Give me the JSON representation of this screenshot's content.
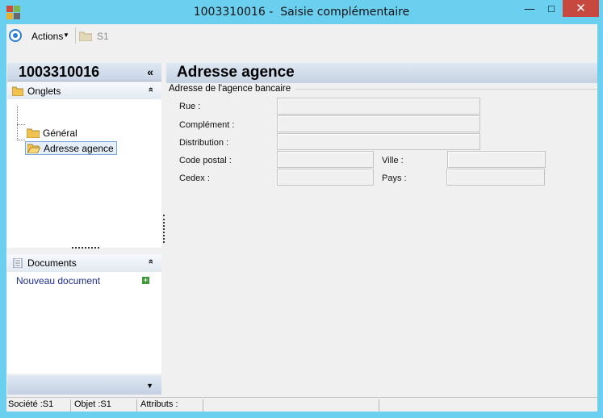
{
  "window": {
    "title": "1003310016 -  Saisie complémentaire",
    "min_glyph": "—",
    "max_glyph": "□",
    "close_glyph": "✕"
  },
  "toolbar": {
    "actions_label": "Actions",
    "caret": "▼",
    "breadcrumb_label": "S1"
  },
  "left": {
    "record_id": "1003310016",
    "collapse_glyph": "«",
    "tabs_section": {
      "label": "Onglets",
      "chevron": "»",
      "items": [
        {
          "label": "Général"
        },
        {
          "label": "Adresse agence",
          "selected": true
        }
      ]
    },
    "documents_section": {
      "label": "Documents",
      "chevron": "»",
      "new_document_label": "Nouveau document",
      "add_glyph": "+"
    },
    "bottom_caret": "▼"
  },
  "main": {
    "page_title": "Adresse agence",
    "group_title": "Adresse de l'agence bancaire",
    "fields": {
      "rue": {
        "label": "Rue :",
        "value": ""
      },
      "complement": {
        "label": "Complément :",
        "value": ""
      },
      "distribution": {
        "label": "Distribution :",
        "value": ""
      },
      "code_postal": {
        "label": "Code postal :",
        "value": ""
      },
      "ville": {
        "label": "Ville :",
        "value": ""
      },
      "cedex": {
        "label": "Cedex :",
        "value": ""
      },
      "pays": {
        "label": "Pays :",
        "value": ""
      }
    }
  },
  "statusbar": {
    "societe": "Société :S1",
    "objet": "Objet :S1",
    "attributs": "Attributs :"
  },
  "colors": {
    "frame": "#6bcff0",
    "close_button": "#c7483f",
    "header_gradient_top": "#dfe8f3",
    "header_gradient_bottom": "#c5d2e3",
    "link": "#1f2f8f",
    "add_icon": "#3c9a37"
  }
}
